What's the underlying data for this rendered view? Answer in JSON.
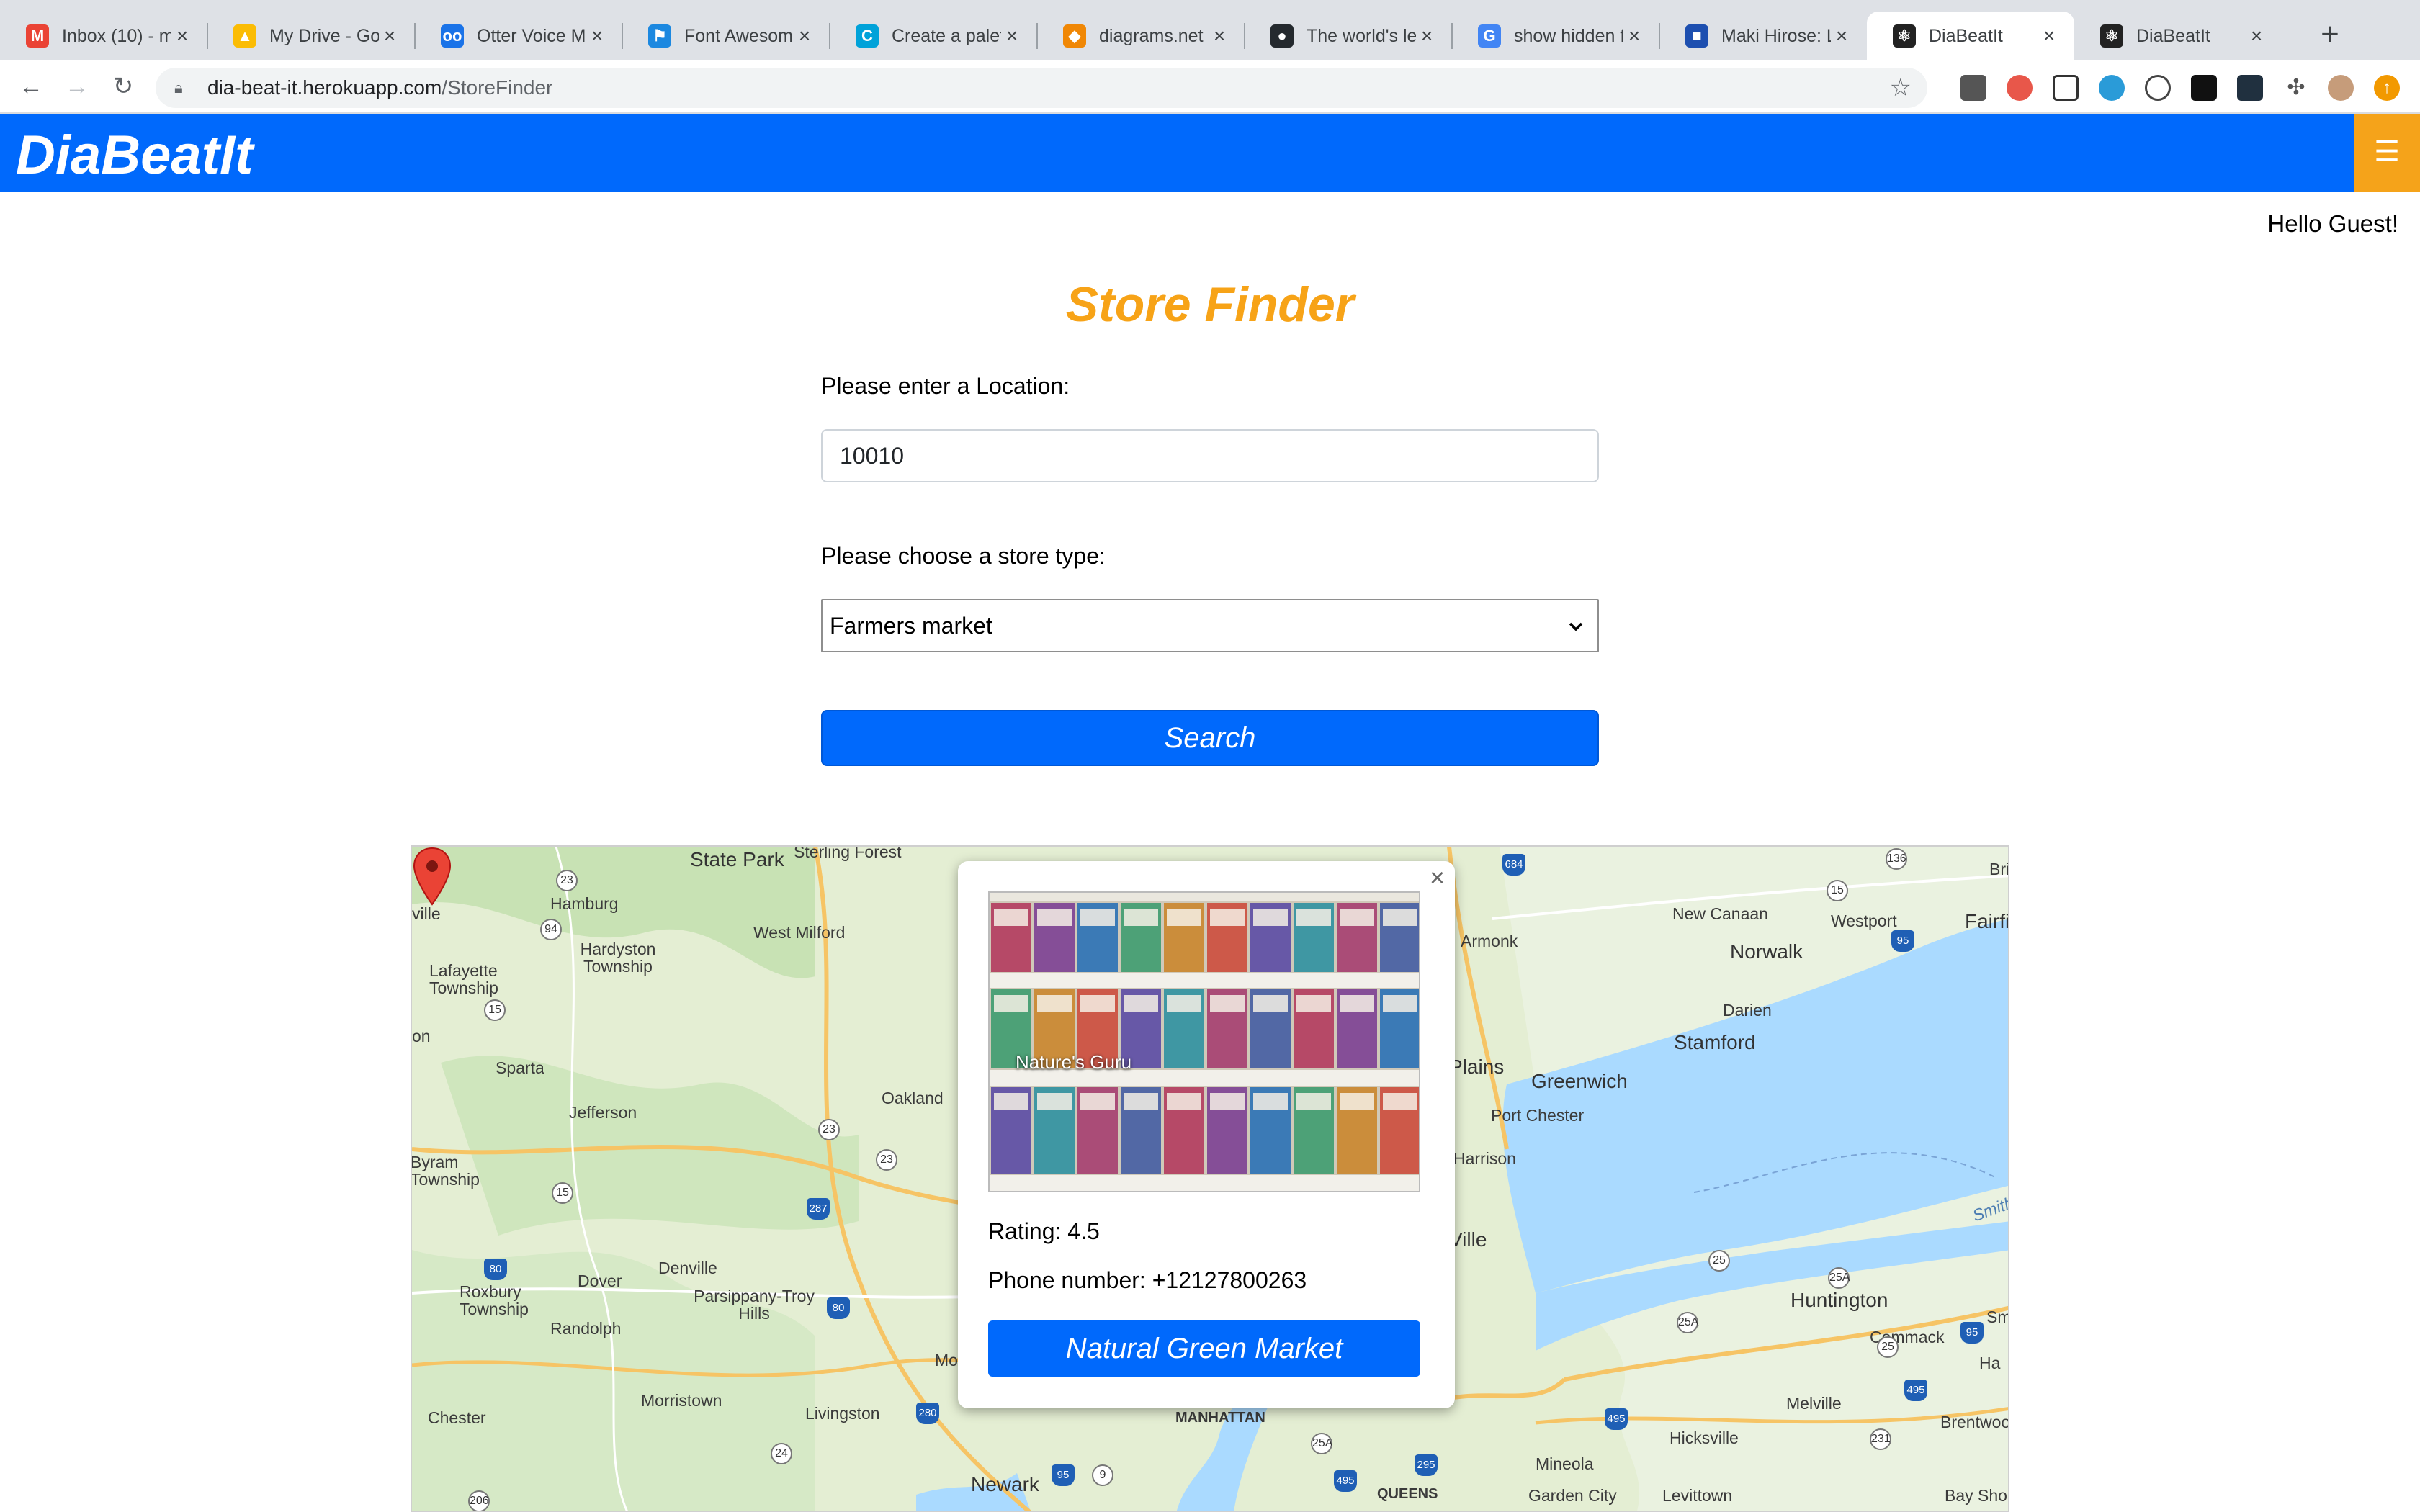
{
  "browser": {
    "tabs": [
      {
        "title": "Inbox (10) - m",
        "color": "#ea4335",
        "icon": "gmail-icon",
        "glyph": "M"
      },
      {
        "title": "My Drive - Go",
        "color": "#fbbc04",
        "icon": "drive-icon",
        "glyph": "▲"
      },
      {
        "title": "Otter Voice M",
        "color": "#1a73e8",
        "icon": "otter-icon",
        "glyph": "oo"
      },
      {
        "title": "Font Awesome",
        "color": "#1c88e0",
        "icon": "font-awesome-icon",
        "glyph": "⚑"
      },
      {
        "title": "Create a palet",
        "color": "#00a2d9",
        "icon": "coolors-icon",
        "glyph": "C"
      },
      {
        "title": "diagrams.net",
        "color": "#f08705",
        "icon": "diagrams-icon",
        "glyph": "◆"
      },
      {
        "title": "The world's le",
        "color": "#24292e",
        "icon": "github-icon",
        "glyph": "●"
      },
      {
        "title": "show hidden f",
        "color": "#4285f4",
        "icon": "google-icon",
        "glyph": "G"
      },
      {
        "title": "Maki Hirose: L",
        "color": "#1d4fb0",
        "icon": "page-icon",
        "glyph": "■"
      },
      {
        "title": "DiaBeatIt",
        "color": "#222222",
        "icon": "react-icon",
        "glyph": "⚛"
      },
      {
        "title": "DiaBeatIt",
        "color": "#222222",
        "icon": "react-icon",
        "glyph": "⚛"
      }
    ],
    "active_tab": 9,
    "url_host": "dia-beat-it.herokuapp.com",
    "url_path": "/StoreFinder"
  },
  "app": {
    "brand": "DiaBeatIt",
    "greeting": "Hello Guest!",
    "accent": "#0069fc",
    "menu_color": "#f5a31a"
  },
  "page": {
    "title": "Store Finder",
    "title_color": "#f7a317",
    "location_label": "Please enter a Location:",
    "location_value": "10010",
    "store_type_label": "Please choose a store type:",
    "store_type_value": "Farmers market",
    "search_label": "Search"
  },
  "map": {
    "labels": [
      "State Park",
      "Sterling Forest",
      "Hamburg",
      "West Milford",
      "Hardyston Township",
      "Lafayette Township",
      "Sparta",
      "Jefferson",
      "Oakland",
      "Byram Township",
      "Denville",
      "Parsippany-Troy Hills",
      "Dover",
      "Roxbury Township",
      "Randolph",
      "Morristown",
      "Livingston",
      "Chester",
      "Newark",
      "QUEENS",
      "MANHATTAN",
      "Armonk",
      "New Canaan",
      "Westport",
      "Fairfield",
      "Norwalk",
      "Darien",
      "Stamford",
      "Greenwich",
      "Port Chester",
      "Harrison",
      "Huntington",
      "Commack",
      "Melville",
      "Hicksville",
      "Mineola",
      "Garden City",
      "Levittown",
      "Brentwood",
      "Bay Shore",
      "Plains",
      "Ville",
      "on",
      "ville",
      "Mo",
      "Smith",
      "Ha",
      "Bri",
      "Sm"
    ],
    "popup": {
      "photo_caption": "Nature's Guru",
      "rating_text": "Rating: 4.5",
      "phone_text": "Phone number: +12127800263",
      "store_name": "Natural Green Market"
    }
  }
}
